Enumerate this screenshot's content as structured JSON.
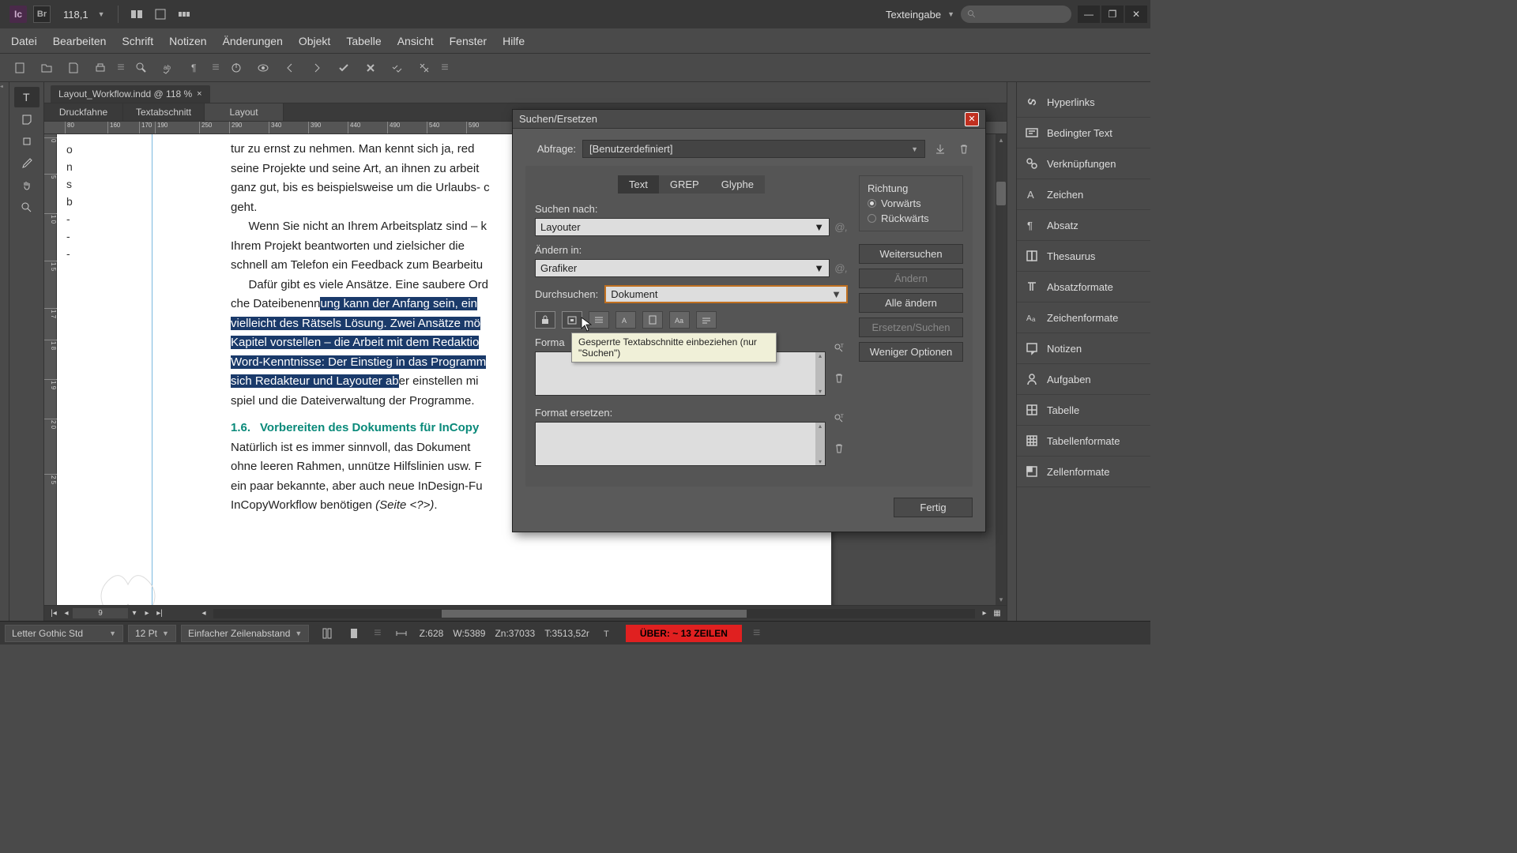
{
  "titlebar": {
    "zoom": "118,1",
    "workspace": "Texteingabe"
  },
  "menu": [
    "Datei",
    "Bearbeiten",
    "Schrift",
    "Notizen",
    "Änderungen",
    "Objekt",
    "Tabelle",
    "Ansicht",
    "Fenster",
    "Hilfe"
  ],
  "doc": {
    "tab": "Layout_Workflow.indd @ 118 %"
  },
  "viewTabs": [
    "Druckfahne",
    "Textabschnitt",
    "Layout"
  ],
  "rulerH": [
    "80",
    "160",
    "170",
    "190",
    "250",
    "290",
    "340",
    "390",
    "440",
    "490",
    "540",
    "590"
  ],
  "rulerV": [
    "0",
    "5",
    "1\n0",
    "1\n5",
    "1\n7",
    "1\n8",
    "1\n9",
    "2\n0",
    "2\n5"
  ],
  "letterCol": [
    "o",
    "n",
    "s",
    "b",
    "-",
    "-",
    "-"
  ],
  "body": {
    "p1a": "tur zu ernst zu nehmen. Man kennt sich ja, red",
    "p1b": "seine Projekte und seine Art, an ihnen zu arbeit",
    "p1c": "ganz gut, bis es beispielsweise um die Urlaubs- c",
    "p1d": "geht.",
    "p2a": "Wenn Sie nicht an Ihrem Arbeitsplatz sind – k",
    "p2b": "Ihrem Projekt beantworten und zielsicher die",
    "p2c": "schnell am Telefon ein Feedback zum Bearbeitu",
    "p3a": "Dafür gibt es viele Ansätze. Eine saubere Ord",
    "p3b_pre": "che Dateibenenn",
    "p3b_sel": "ung kann der Anfang sein, ein",
    "p3c_sel": "vielleicht des Rätsels Lösung. Zwei Ansätze mö",
    "p3d_sel": "Kapitel vorstellen – die Arbeit mit dem Redaktio",
    "p3e_sel": "Word-Kenntnisse: Der Einstieg in das Programm",
    "p3f_sel": "sich Redakteur und Layouter ab",
    "p3f_post": "er einstellen mi",
    "p3g": "spiel und die Dateiverwaltung der Programme.",
    "head_num": "1.6.",
    "head_txt": "Vorbereiten des Dokuments für InCopy",
    "p4a": "Natürlich ist es immer sinnvoll, das Dokument",
    "p4b": "ohne leeren Rahmen, unnütze Hilfslinien usw. F",
    "p4c": "ein paar bekannte, aber auch neue InDesign-Fu",
    "p4d_a": "InCopyWorkflow benötigen ",
    "p4d_i": "(Seite <?>)",
    "p4d_b": "."
  },
  "pageNav": {
    "num": "9"
  },
  "panels": [
    "Hyperlinks",
    "Bedingter Text",
    "Verknüpfungen",
    "Zeichen",
    "Absatz",
    "Thesaurus",
    "Absatzformate",
    "Zeichenformate",
    "Notizen",
    "Aufgaben",
    "Tabelle",
    "Tabellenformate",
    "Zellenformate"
  ],
  "status": {
    "font": "Letter Gothic Std",
    "size": "12 Pt",
    "leading": "Einfacher Zeilenabstand",
    "z": "Z:628",
    "w": "W:5389",
    "zn": "Zn:37033",
    "t": "T:3513,52r",
    "warn": "ÜBER:  ~ 13 ZEILEN"
  },
  "dialog": {
    "title": "Suchen/Ersetzen",
    "query_lbl": "Abfrage:",
    "query_val": "[Benutzerdefiniert]",
    "tabs": [
      "Text",
      "GREP",
      "Glyphe"
    ],
    "find_lbl": "Suchen nach:",
    "find_val": "Layouter",
    "change_lbl": "Ändern in:",
    "change_val": "Grafiker",
    "scope_lbl": "Durchsuchen:",
    "scope_val": "Dokument",
    "special": "@",
    "tooltip": "Gesperrte Textabschnitte einbeziehen (nur \"Suchen\")",
    "fmt_find_lbl": "Forma",
    "fmt_change_lbl": "Format ersetzen:",
    "dir_lbl": "Richtung",
    "dir_fwd": "Vorwärts",
    "dir_bwd": "Rückwärts",
    "btn_next": "Weitersuchen",
    "btn_change": "Ändern",
    "btn_all": "Alle ändern",
    "btn_changefind": "Ersetzen/Suchen",
    "btn_less": "Weniger Optionen",
    "btn_done": "Fertig"
  }
}
